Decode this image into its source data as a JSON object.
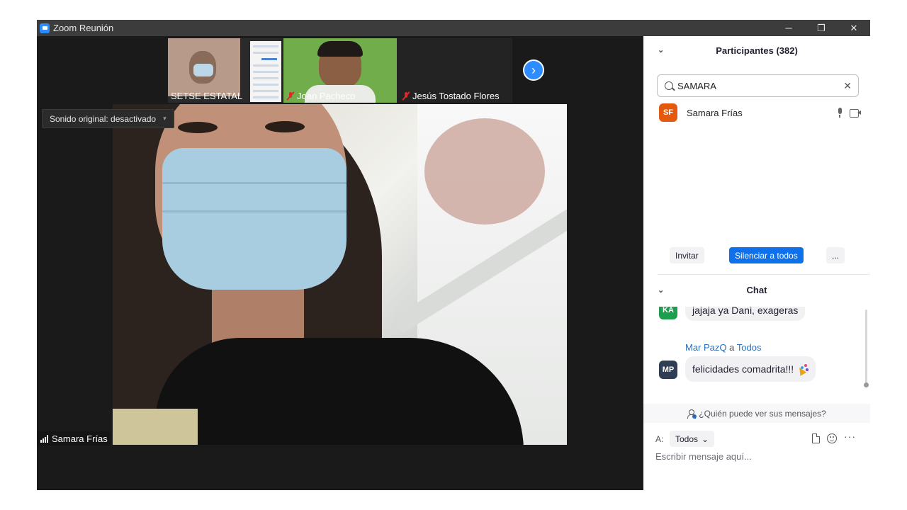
{
  "window": {
    "title": "Zoom Reunión",
    "controls": {
      "minimize": "─",
      "restore": "❐",
      "close": "✕"
    }
  },
  "strip": {
    "tiles": [
      {
        "name": "SETSE ESTATAL",
        "muted": false
      },
      {
        "name": "Joan Pacheco",
        "muted": true
      },
      {
        "name": "Jesús Tostado Flores",
        "muted": true
      }
    ],
    "next_icon": "›"
  },
  "main_video": {
    "speaker_name": "Samara Frías",
    "sound_tooltip": "Sonido original: desactivado",
    "sound_caret": "▾"
  },
  "participants": {
    "header": "Participantes (382)",
    "chevron": "⌄",
    "search": {
      "value": "SAMARA",
      "clear": "✕"
    },
    "list": [
      {
        "initials": "SF",
        "name": "Samara Frías",
        "color": "#e35a0e"
      }
    ],
    "actions": {
      "invite": "Invitar",
      "mute_all": "Silenciar a todos",
      "more": "..."
    }
  },
  "chat": {
    "header": "Chat",
    "chevron": "⌄",
    "messages": [
      {
        "initials": "KA",
        "text": "jajaja ya Dani, exageras",
        "color": "#1d9e4f"
      },
      {
        "initials": "MP",
        "sender": "Mar PazQ",
        "connector": "a",
        "recipient": "Todos",
        "text": "felicidades comadrita!!!",
        "color": "#2f3e52"
      }
    ],
    "who_can_see": "¿Quién puede ver sus mensajes?",
    "to_label": "A:",
    "to_value": "Todos",
    "to_caret": "⌄",
    "more_icon": "···",
    "input_placeholder": "Escribir mensaje aquí..."
  },
  "colors": {
    "accent": "#0e71eb",
    "title_bar": "#3c3c3c",
    "meeting_bg": "#1a1a1a"
  }
}
